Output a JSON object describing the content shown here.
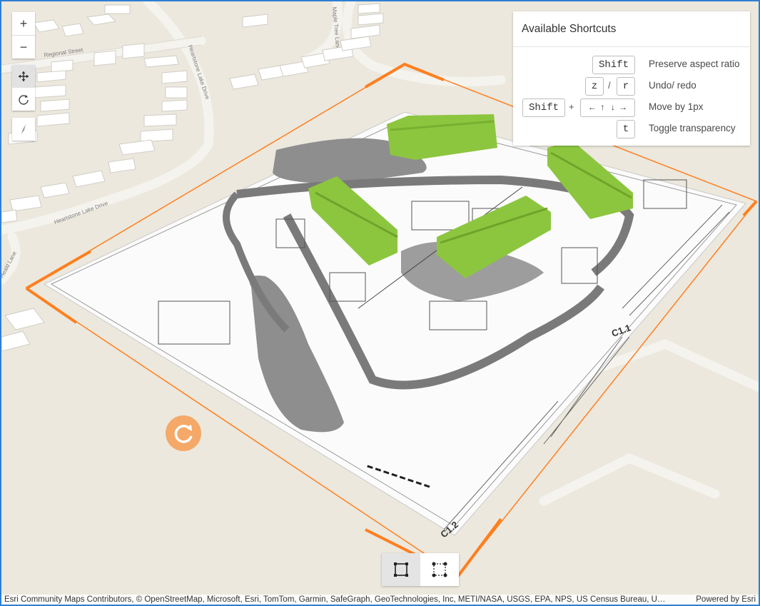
{
  "map": {
    "street_labels": [
      "Regional Street",
      "Heartstone Lake Drive",
      "Heartstone Lake Drive",
      "Maple Tree Lane",
      "Heald Lane"
    ],
    "sheet_labels": [
      "C1.1",
      "C1.2"
    ]
  },
  "zoom": {
    "in_label": "+",
    "out_label": "−"
  },
  "navigation": {
    "pan": "pan-icon",
    "rotate": "rotate-icon",
    "compass": "compass-icon"
  },
  "shortcuts": {
    "title": "Available Shortcuts",
    "rows": [
      {
        "keys": [
          "Shift"
        ],
        "separator": "",
        "description": "Preserve aspect ratio"
      },
      {
        "keys": [
          "z",
          "r"
        ],
        "separator": "/",
        "description": "Undo/ redo"
      },
      {
        "keys": [
          "Shift",
          "← ↑ ↓ →"
        ],
        "separator": "+",
        "description": "Move by 1px"
      },
      {
        "keys": [
          "t"
        ],
        "separator": "",
        "description": "Toggle transparency"
      }
    ]
  },
  "mode_toolbar": {
    "modes": [
      "transform-box-icon",
      "reshape-points-icon"
    ],
    "selected": 0
  },
  "attribution": {
    "text": "Esri Community Maps Contributors, © OpenStreetMap, Microsoft, Esri, TomTom, Garmin, SafeGraph, GeoTechnologies, Inc, METI/NASA, USGS, EPA, NPS, US Census Bureau, U…",
    "powered_by": "Powered by Esri"
  },
  "colors": {
    "accent": "#ff7f1f",
    "building_green": "#8cc63f",
    "focus_border": "#2f7fd4"
  }
}
